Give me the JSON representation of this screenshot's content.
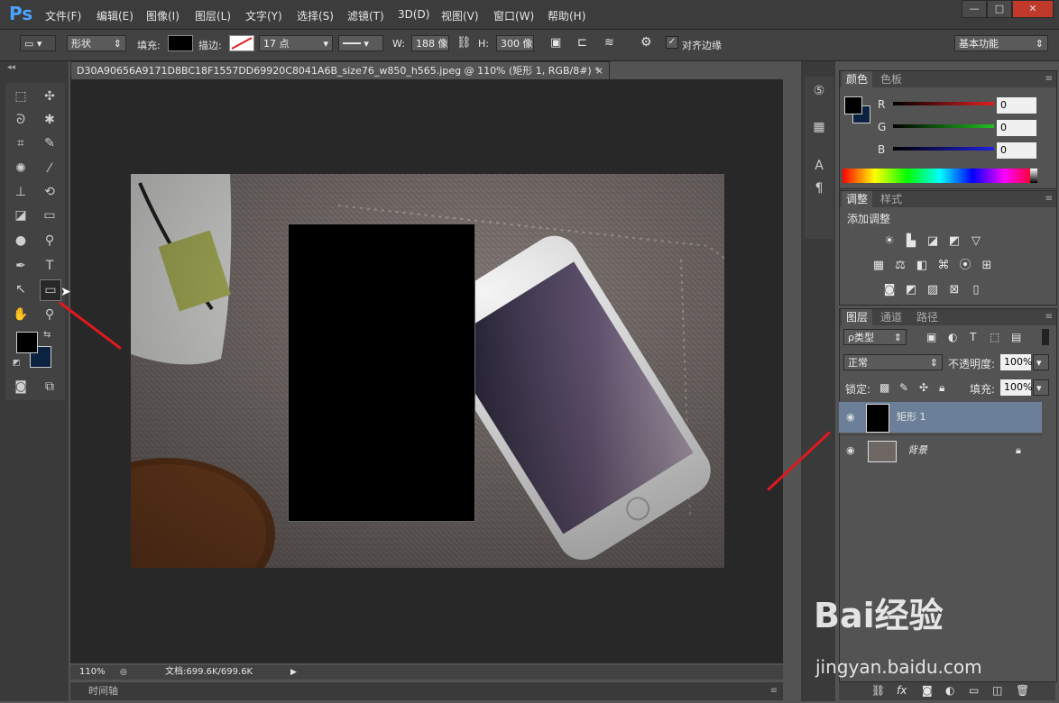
{
  "app": {
    "logo": "Ps"
  },
  "menu": [
    "文件(F)",
    "编辑(E)",
    "图像(I)",
    "图层(L)",
    "文字(Y)",
    "选择(S)",
    "滤镜(T)",
    "3D(D)",
    "视图(V)",
    "窗口(W)",
    "帮助(H)"
  ],
  "window_controls": {
    "minimize": "—",
    "maximize": "□",
    "close": "✕"
  },
  "options": {
    "mode": "形状",
    "fill_label": "填充:",
    "stroke_label": "描边:",
    "stroke_size": "17 点",
    "w_label": "W:",
    "w_value": "188 像",
    "h_label": "H:",
    "h_value": "300 像",
    "align_edges": "对齐边缘",
    "workspace": "基本功能"
  },
  "document": {
    "tab_title": "D30A90656A9171D8BC18F1557DD69920C8041A6B_size76_w850_h565.jpeg @ 110% (矩形 1, RGB/8#) *",
    "close_glyph": "×",
    "zoom": "110%",
    "doc_info": "文档:699.6K/699.6K"
  },
  "timeline": {
    "label": "时间轴"
  },
  "color_panel": {
    "tabs": [
      "颜色",
      "色板"
    ],
    "channels": [
      {
        "label": "R",
        "value": "0",
        "color": "#e02020"
      },
      {
        "label": "G",
        "value": "0",
        "color": "#20c020"
      },
      {
        "label": "B",
        "value": "0",
        "color": "#2020e0"
      }
    ]
  },
  "adjust_panel": {
    "tabs": [
      "调整",
      "样式"
    ],
    "title": "添加调整"
  },
  "layers_panel": {
    "tabs": [
      "图层",
      "通道",
      "路径"
    ],
    "filter": "ρ类型",
    "blend_mode": "正常",
    "opacity_label": "不透明度:",
    "opacity": "100%",
    "lock_label": "锁定:",
    "fill_label": "填充:",
    "fill": "100%",
    "layers": [
      {
        "name": "矩形 1",
        "selected": true
      },
      {
        "name": "背景",
        "selected": false
      }
    ]
  },
  "watermark": {
    "brand": "Bai经验",
    "url": "jingyan.baidu.com"
  },
  "colors": {
    "accent_selection": "#6b8098",
    "foreground": "#000000",
    "background": "#0b2240"
  }
}
